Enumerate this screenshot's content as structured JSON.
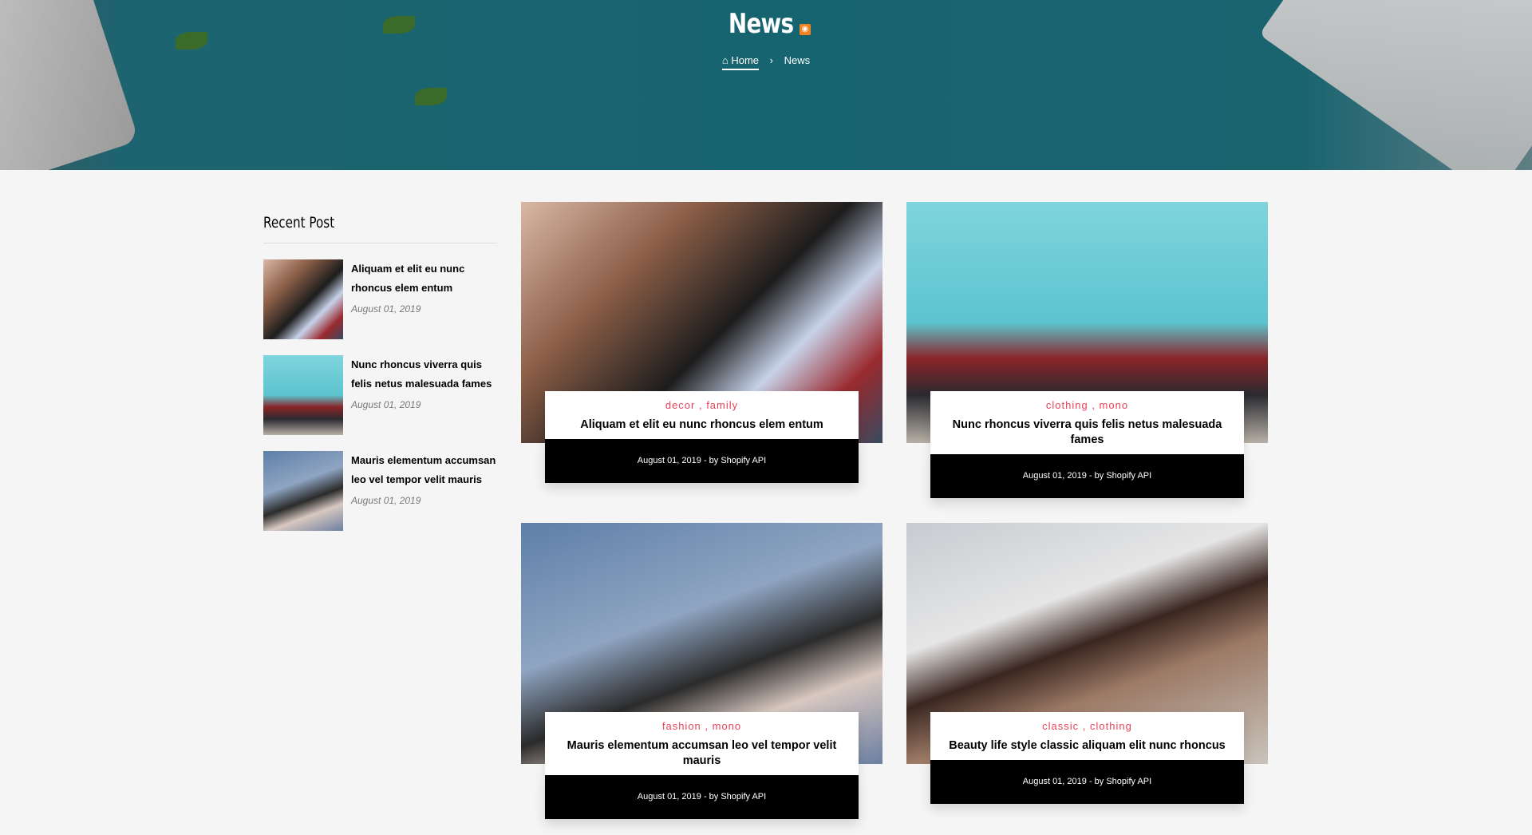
{
  "header": {
    "title": "News",
    "rss_icon": "rss-icon",
    "breadcrumb": {
      "home": "Home",
      "separator": "›",
      "current": "News"
    }
  },
  "sidebar": {
    "title": "Recent Post",
    "posts": [
      {
        "title": "Aliquam et elit eu nunc rhoncus elem entum",
        "date": "August 01, 2019"
      },
      {
        "title": "Nunc rhoncus viverra quis felis netus malesuada fames",
        "date": "August 01, 2019"
      },
      {
        "title": "Mauris elementum accumsan leo vel tempor velit mauris",
        "date": "August 01, 2019"
      }
    ]
  },
  "posts": [
    {
      "tags": "decor , family",
      "title": "Aliquam et elit eu nunc rhoncus elem entum",
      "meta": "August 01, 2019 - by Shopify API"
    },
    {
      "tags": "clothing , mono",
      "title": "Nunc rhoncus viverra quis felis netus malesuada fames",
      "meta": "August 01, 2019 - by Shopify API"
    },
    {
      "tags": "fashion , mono",
      "title": "Mauris elementum accumsan leo vel tempor velit mauris",
      "meta": "August 01, 2019 - by Shopify API"
    },
    {
      "tags": "classic , clothing",
      "title": "Beauty life style classic aliquam elit nunc rhoncus",
      "meta": "August 01, 2019 - by Shopify API"
    }
  ],
  "colors": {
    "banner": "#166470",
    "tag": "#e8435a",
    "meta_bg": "#000000"
  }
}
